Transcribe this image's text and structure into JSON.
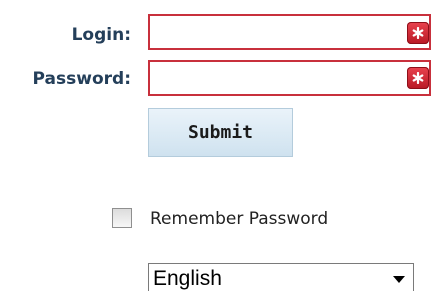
{
  "login_form": {
    "login_label": "Login:",
    "login_value": "",
    "password_label": "Password:",
    "password_value": "",
    "required_icon": "asterisk-icon",
    "submit_label": "Submit",
    "remember_label": "Remember Password",
    "remember_checked": false,
    "language_selected": "English",
    "dropdown_icon": "chevron-down-icon"
  },
  "colors": {
    "label_text": "#243f5a",
    "required_border": "#c8303c",
    "required_icon_bg": "#d42c38",
    "submit_bg": "#dbeaf4",
    "submit_border": "#b4ccdc"
  }
}
